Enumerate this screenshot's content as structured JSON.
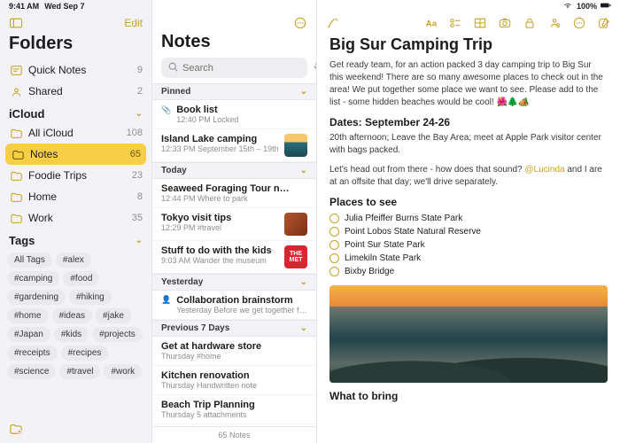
{
  "statusbar": {
    "time": "9:41 AM",
    "date": "Wed Sep 7",
    "battery": "100%"
  },
  "sidebar": {
    "edit": "Edit",
    "title": "Folders",
    "quick": {
      "label": "Quick Notes",
      "count": "9"
    },
    "shared": {
      "label": "Shared",
      "count": "2"
    },
    "icloud": "iCloud",
    "folders": [
      {
        "label": "All iCloud",
        "count": "108"
      },
      {
        "label": "Notes",
        "count": "65"
      },
      {
        "label": "Foodie Trips",
        "count": "23"
      },
      {
        "label": "Home",
        "count": "8"
      },
      {
        "label": "Work",
        "count": "35"
      }
    ],
    "tagsHead": "Tags",
    "tags": [
      "All Tags",
      "#alex",
      "#camping",
      "#food",
      "#gardening",
      "#hiking",
      "#home",
      "#ideas",
      "#jake",
      "#Japan",
      "#kids",
      "#projects",
      "#receipts",
      "#recipes",
      "#science",
      "#travel",
      "#work"
    ]
  },
  "list": {
    "title": "Notes",
    "searchPlaceholder": "Search",
    "groups": {
      "pinned": "Pinned",
      "today": "Today",
      "yesterday": "Yesterday",
      "prev7": "Previous 7 Days"
    },
    "pinned": [
      {
        "title": "Book list",
        "sub": "12:40 PM  Locked"
      },
      {
        "title": "Island Lake camping",
        "sub": "12:33 PM  September 15th – 19th"
      }
    ],
    "today": [
      {
        "title": "Seaweed Foraging Tour n…",
        "sub": "12:44 PM  Where to park"
      },
      {
        "title": "Tokyo visit tips",
        "sub": "12:29 PM  #travel"
      },
      {
        "title": "Stuff to do with the kids",
        "sub": "9:03 AM  Wander the museum"
      }
    ],
    "yesterday": [
      {
        "title": "Collaboration brainstorm",
        "sub": "Yesterday  Before we get together for our…"
      }
    ],
    "prev7": [
      {
        "title": "Get at hardware store",
        "sub": "Thursday  #home"
      },
      {
        "title": "Kitchen renovation",
        "sub": "Thursday  Handwritten note"
      },
      {
        "title": "Beach Trip Planning",
        "sub": "Thursday  5 attachments"
      }
    ],
    "footer": "65 Notes"
  },
  "doc": {
    "title": "Big Sur Camping Trip",
    "p1": "Get ready team, for an action packed 3 day camping trip to Big Sur this weekend! There are so many awesome places to check out in the area! We put together some place we want to see. Please add to the list - some hidden beaches would be cool! 🌺🌲🏕️",
    "datesHead": "Dates: September 24-26",
    "p2a": "20th afternoon; Leave the Bay Area; meet at Apple Park visitor center with bags packed.",
    "p2b_pre": "Let's head out from there - how does that sound? ",
    "mention": "@Lucinda",
    "p2b_post": " and I are at an offsite that day; we'll drive separately.",
    "placesHead": "Places to see",
    "places": [
      "Julia Pfeiffer Burns State Park",
      "Point Lobos State Natural Reserve",
      "Point Sur State Park",
      "Limekiln State Park",
      "Bixby Bridge"
    ],
    "bringHead": "What to bring"
  }
}
